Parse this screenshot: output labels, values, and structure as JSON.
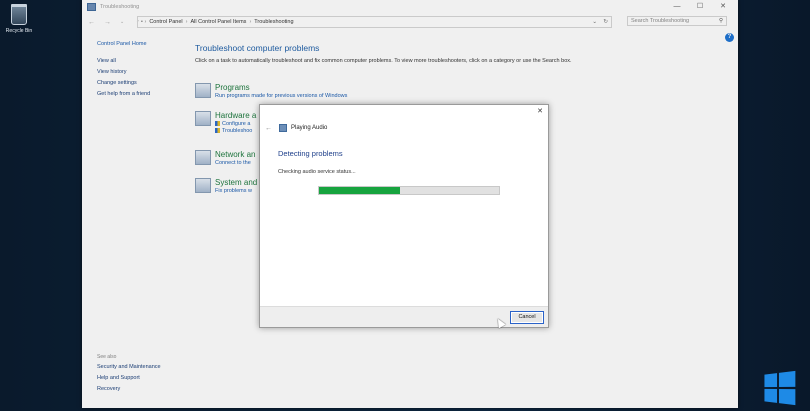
{
  "desktop": {
    "recycle_bin_label": "Recycle Bin"
  },
  "window": {
    "title": "Troubleshooting",
    "address": [
      "Control Panel",
      "All Control Panel Items",
      "Troubleshooting"
    ],
    "search_placeholder": "Search Troubleshooting"
  },
  "sidebar": {
    "home": "Control Panel Home",
    "items": [
      "View all",
      "View history",
      "Change settings",
      "Get help from a friend"
    ],
    "see_also_header": "See also",
    "see_also": [
      "Security and Maintenance",
      "Help and Support",
      "Recovery"
    ]
  },
  "main": {
    "title": "Troubleshoot computer problems",
    "description": "Click on a task to automatically troubleshoot and fix common computer problems. To view more troubleshooters, click on a category or use the Search box.",
    "categories": [
      {
        "name": "Programs",
        "links": [
          "Run programs made for previous versions of Windows"
        ]
      },
      {
        "name": "Hardware a",
        "links": [
          "Configure a",
          "Troubleshoo"
        ]
      },
      {
        "name": "Network an",
        "links": [
          "Connect to the"
        ]
      },
      {
        "name": "System and",
        "links": [
          "Fix problems w"
        ]
      }
    ]
  },
  "dialog": {
    "breadcrumb": "Playing Audio",
    "heading": "Detecting problems",
    "status": "Checking audio service status...",
    "progress": 0.45,
    "cancel_label": "Cancel"
  },
  "colors": {
    "progress_fill": "#17a43f",
    "link": "#1a5cb0",
    "category": "#1e7a3f"
  }
}
